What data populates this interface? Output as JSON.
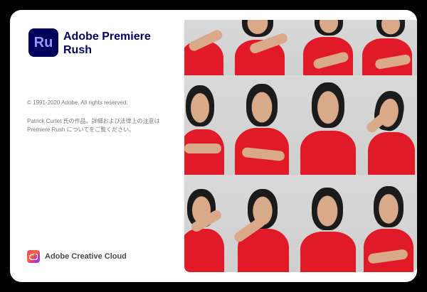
{
  "app": {
    "logo_text": "Ru",
    "name": "Adobe Premiere Rush",
    "brand_color": "#00005b",
    "logo_text_color": "#9999ff"
  },
  "copyright": "© 1991-2020 Adobe. All rights reserved.",
  "credit": "Patrick Curtet 氏の作品。詳細および法律上の注意は Premiere Rush についてをご覧ください。",
  "footer": {
    "icon": "creative-cloud-icon",
    "label": "Adobe Creative Cloud"
  },
  "photo_grid": {
    "description_icon": "photo-collage",
    "shirt_color": "#e01a26"
  }
}
